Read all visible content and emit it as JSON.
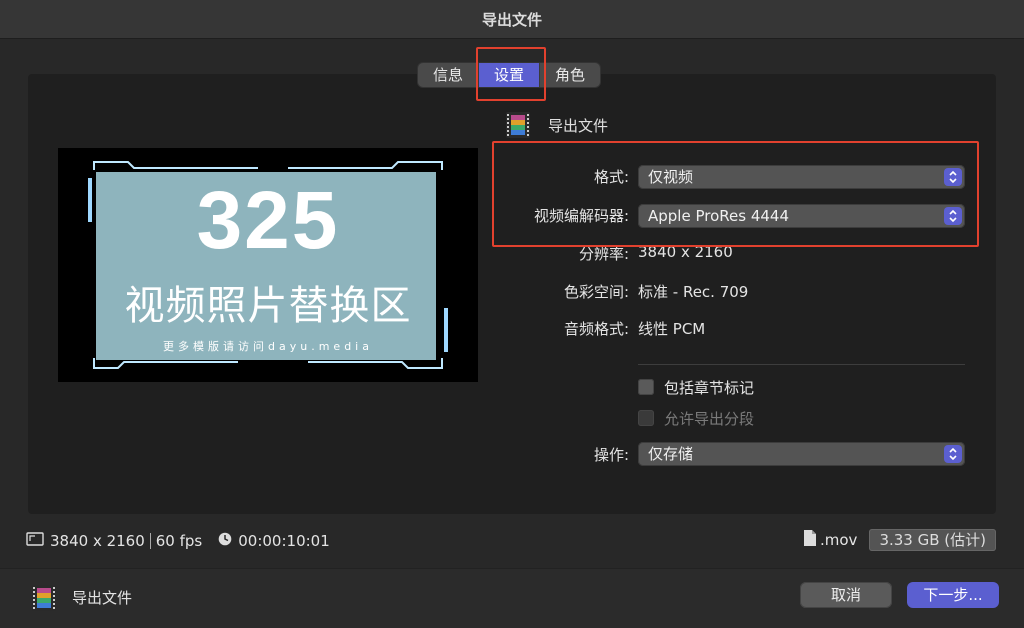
{
  "window": {
    "title": "导出文件"
  },
  "tabs": [
    {
      "label": "信息",
      "active": false
    },
    {
      "label": "设置",
      "active": true
    },
    {
      "label": "角色",
      "active": false
    }
  ],
  "preview": {
    "number": "325",
    "title": "视频照片替换区",
    "subtitle": "更多模版请访问dayu.media"
  },
  "header": {
    "label": "导出文件",
    "icon": "film-strip-icon"
  },
  "settings": {
    "format": {
      "label": "格式:",
      "value": "仅视频"
    },
    "codec": {
      "label": "视频编解码器:",
      "value": "Apple ProRes 4444"
    },
    "resolution": {
      "label": "分辨率:",
      "value": "3840 x 2160"
    },
    "color_space": {
      "label": "色彩空间:",
      "value": "标准 - Rec. 709"
    },
    "audio_format": {
      "label": "音频格式:",
      "value": "线性 PCM"
    },
    "include_chapters": {
      "label": "包括章节标记",
      "checked": false
    },
    "allow_segments": {
      "label": "允许导出分段",
      "checked": false,
      "disabled": true
    },
    "action": {
      "label": "操作:",
      "value": "仅存储"
    }
  },
  "info_bar": {
    "resolution": "3840 x 2160",
    "fps": "60 fps",
    "duration": "00:00:10:01",
    "extension": ".mov",
    "size": "3.33 GB (估计)"
  },
  "footer": {
    "label": "导出文件",
    "cancel": "取消",
    "next": "下一步..."
  },
  "colors": {
    "accent": "#5b5fd0",
    "highlight": "#e2412e",
    "background": "#282828"
  }
}
